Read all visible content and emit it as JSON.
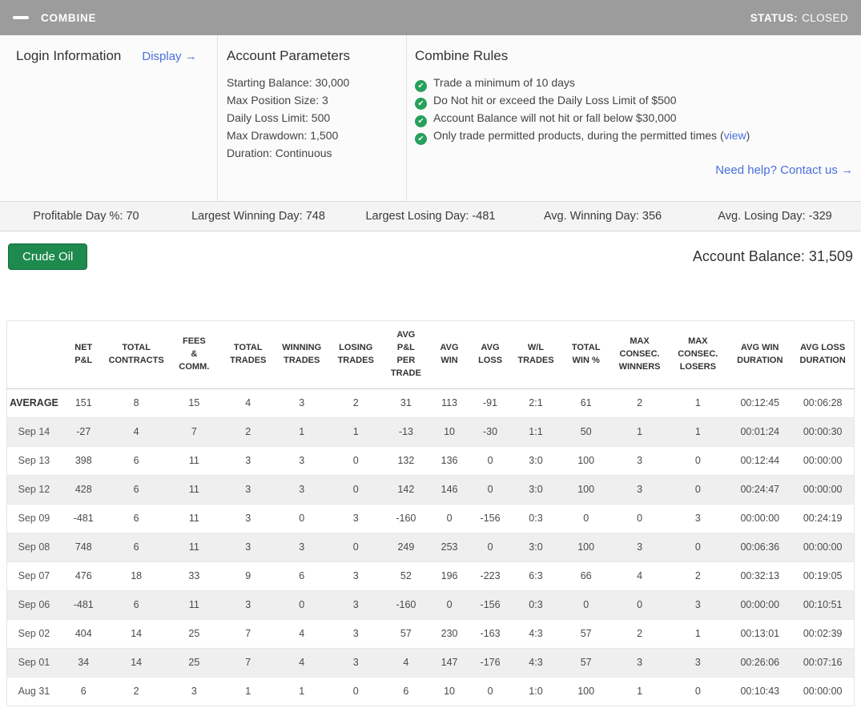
{
  "titlebar": {
    "title": "COMBINE",
    "status_label": "STATUS:",
    "status_value": "CLOSED"
  },
  "icons": {
    "minimize": "—",
    "check": "✔"
  },
  "colors": {
    "titlebar_bg": "#9c9c9c",
    "link_blue": "#4a6fdc",
    "check_green": "#27a05c",
    "button_green": "#1e8a4d"
  },
  "login": {
    "heading": "Login Information",
    "display_link": "Display →"
  },
  "account_parameters": {
    "heading": "Account Parameters",
    "items": [
      "Starting Balance: 30,000",
      "Max Position Size: 3",
      "Daily Loss Limit: 500",
      "Max Drawdown: 1,500",
      "Duration: Continuous"
    ]
  },
  "combine_rules": {
    "heading": "Combine Rules",
    "rules": [
      {
        "text": "Trade a minimum of 10 days"
      },
      {
        "text": "Do Not hit or exceed the Daily Loss Limit of $500"
      },
      {
        "text": "Account Balance will not hit or fall below $30,000"
      },
      {
        "text": "Only trade permitted products, during the permitted times (",
        "link": "view",
        "after": ")"
      }
    ],
    "help_link": "Need help? Contact us →"
  },
  "stats_bar": [
    "Profitable Day %: 70",
    "Largest Winning Day: 748",
    "Largest Losing Day: -481",
    "Avg. Winning Day: 356",
    "Avg. Losing Day: -329"
  ],
  "product_button": "Crude Oil",
  "account_balance": "Account Balance: 31,509",
  "table": {
    "headers": [
      "NET\nP&L",
      "TOTAL\nCONTRACTS",
      "FEES\n&\nCOMM.",
      "TOTAL\nTRADES",
      "WINNING\nTRADES",
      "LOSING\nTRADES",
      "AVG\nP&L\nPER\nTRADE",
      "AVG\nWIN",
      "AVG\nLOSS",
      "W/L\nTRADES",
      "TOTAL\nWIN %",
      "MAX\nCONSEC.\nWINNERS",
      "MAX\nCONSEC.\nLOSERS",
      "AVG WIN\nDURATION",
      "AVG LOSS\nDURATION"
    ],
    "rows": [
      {
        "label": "AVERAGE",
        "bold": true,
        "values": [
          "151",
          "8",
          "15",
          "4",
          "3",
          "2",
          "31",
          "113",
          "-91",
          "2:1",
          "61",
          "2",
          "1",
          "00:12:45",
          "00:06:28"
        ]
      },
      {
        "label": "Sep 14",
        "bold": false,
        "values": [
          "-27",
          "4",
          "7",
          "2",
          "1",
          "1",
          "-13",
          "10",
          "-30",
          "1:1",
          "50",
          "1",
          "1",
          "00:01:24",
          "00:00:30"
        ]
      },
      {
        "label": "Sep 13",
        "bold": false,
        "values": [
          "398",
          "6",
          "11",
          "3",
          "3",
          "0",
          "132",
          "136",
          "0",
          "3:0",
          "100",
          "3",
          "0",
          "00:12:44",
          "00:00:00"
        ]
      },
      {
        "label": "Sep 12",
        "bold": false,
        "values": [
          "428",
          "6",
          "11",
          "3",
          "3",
          "0",
          "142",
          "146",
          "0",
          "3:0",
          "100",
          "3",
          "0",
          "00:24:47",
          "00:00:00"
        ]
      },
      {
        "label": "Sep 09",
        "bold": false,
        "values": [
          "-481",
          "6",
          "11",
          "3",
          "0",
          "3",
          "-160",
          "0",
          "-156",
          "0:3",
          "0",
          "0",
          "3",
          "00:00:00",
          "00:24:19"
        ]
      },
      {
        "label": "Sep 08",
        "bold": false,
        "values": [
          "748",
          "6",
          "11",
          "3",
          "3",
          "0",
          "249",
          "253",
          "0",
          "3:0",
          "100",
          "3",
          "0",
          "00:06:36",
          "00:00:00"
        ]
      },
      {
        "label": "Sep 07",
        "bold": false,
        "values": [
          "476",
          "18",
          "33",
          "9",
          "6",
          "3",
          "52",
          "196",
          "-223",
          "6:3",
          "66",
          "4",
          "2",
          "00:32:13",
          "00:19:05"
        ]
      },
      {
        "label": "Sep 06",
        "bold": false,
        "values": [
          "-481",
          "6",
          "11",
          "3",
          "0",
          "3",
          "-160",
          "0",
          "-156",
          "0:3",
          "0",
          "0",
          "3",
          "00:00:00",
          "00:10:51"
        ]
      },
      {
        "label": "Sep 02",
        "bold": false,
        "values": [
          "404",
          "14",
          "25",
          "7",
          "4",
          "3",
          "57",
          "230",
          "-163",
          "4:3",
          "57",
          "2",
          "1",
          "00:13:01",
          "00:02:39"
        ]
      },
      {
        "label": "Sep 01",
        "bold": false,
        "values": [
          "34",
          "14",
          "25",
          "7",
          "4",
          "3",
          "4",
          "147",
          "-176",
          "4:3",
          "57",
          "3",
          "3",
          "00:26:06",
          "00:07:16"
        ]
      },
      {
        "label": "Aug 31",
        "bold": false,
        "values": [
          "6",
          "2",
          "3",
          "1",
          "1",
          "0",
          "6",
          "10",
          "0",
          "1:0",
          "100",
          "1",
          "0",
          "00:10:43",
          "00:00:00"
        ]
      }
    ]
  }
}
